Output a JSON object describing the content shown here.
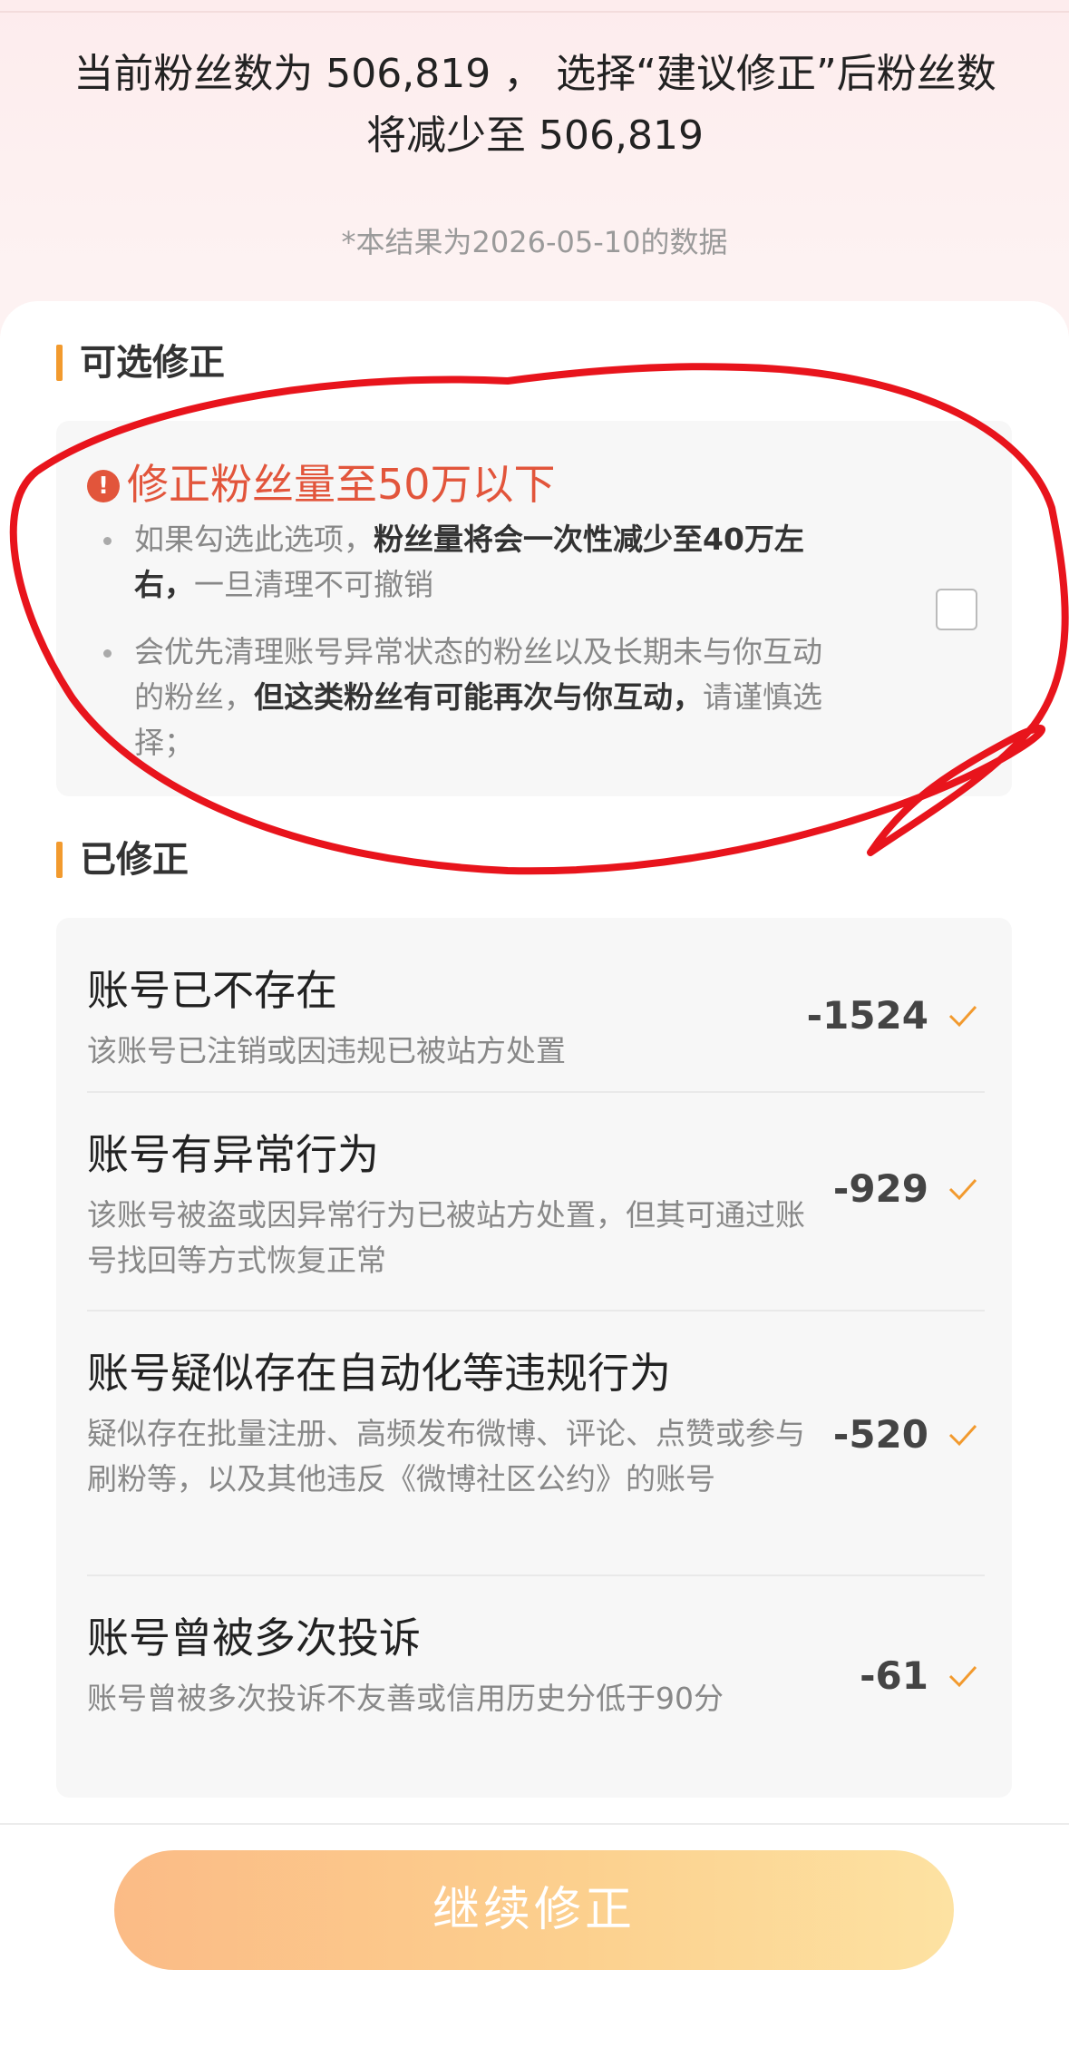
{
  "summary": {
    "text": "当前粉丝数为 506,819 ， 选择“建议修正”后粉丝数将减少至 506,819",
    "date_note": "*本结果为2026-05-10的数据"
  },
  "optional_section": {
    "title": "可选修正",
    "option": {
      "title": "修正粉丝量至50万以下",
      "warn_icon_glyph": "!",
      "bullets": [
        {
          "pre": "如果勾选此选项，",
          "bold": "粉丝量将会一次性减少至40万左右，",
          "post": "一旦清理不可撤销"
        },
        {
          "pre": "会优先清理账号异常状态的粉丝以及长期未与你互动的粉丝，",
          "bold": "但这类粉丝有可能再次与你互动，",
          "post": "请谨慎选择；"
        }
      ],
      "checked": false
    }
  },
  "fixed_section": {
    "title": "已修正",
    "items": [
      {
        "title": "账号已不存在",
        "desc": "该账号已注销或因违规已被站方处置",
        "value": "-1524"
      },
      {
        "title": "账号有异常行为",
        "desc": "该账号被盗或因异常行为已被站方处置，但其可通过账号找回等方式恢复正常",
        "value": "-929"
      },
      {
        "title": "账号疑似存在自动化等违规行为",
        "desc": "疑似存在批量注册、高频发布微博、评论、点赞或参与刷粉等，以及其他违反《微博社区公约》的账号",
        "value": "-520"
      },
      {
        "title": "账号曾被多次投诉",
        "desc": "账号曾被多次投诉不友善或信用历史分低于90分",
        "value": "-61"
      }
    ]
  },
  "cta": {
    "label": "继续修正"
  },
  "colors": {
    "accent": "#f29a2e",
    "warning": "#e2553b",
    "annotation": "#e8141c"
  },
  "icons": {
    "check": "check-icon",
    "warning": "warning-icon",
    "checkbox": "checkbox-empty"
  }
}
